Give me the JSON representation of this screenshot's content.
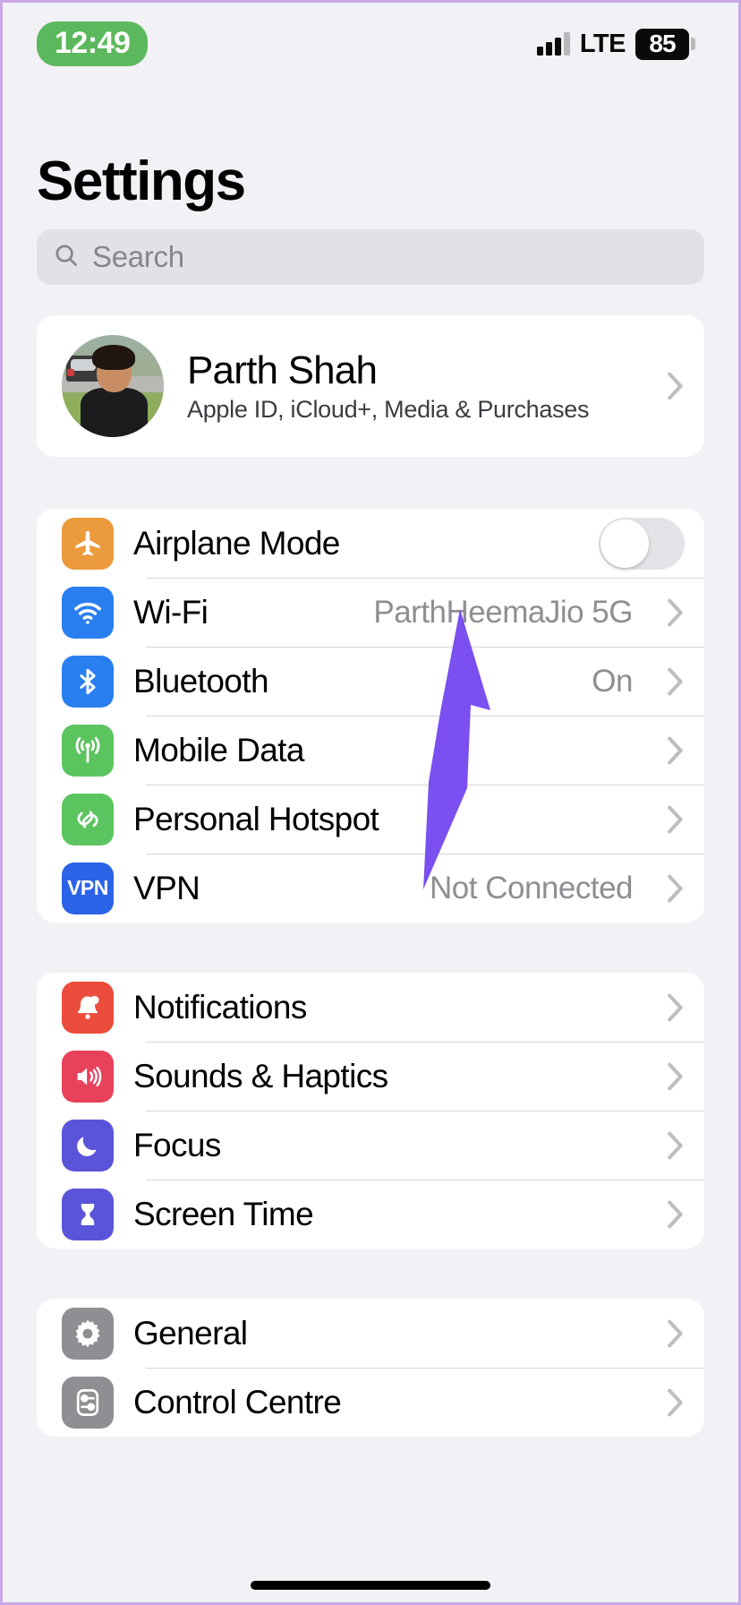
{
  "status_bar": {
    "time": "12:49",
    "network_label": "LTE",
    "battery_level": "85",
    "signal_icon": "cellular-bars-icon",
    "battery_icon": "battery-icon"
  },
  "header": {
    "title": "Settings"
  },
  "search": {
    "placeholder": "Search",
    "icon": "search-icon"
  },
  "account": {
    "name": "Parth Shah",
    "subtitle": "Apple ID, iCloud+, Media & Purchases",
    "avatar_icon": "avatar",
    "chevron_icon": "chevron-right-icon"
  },
  "groups": [
    {
      "id": "connectivity",
      "rows": [
        {
          "label": "Airplane Mode",
          "value": "",
          "icon": "airplane-icon",
          "icon_color": "#eb9a3c",
          "accessory": "toggle",
          "toggle_on": false
        },
        {
          "label": "Wi-Fi",
          "value": "ParthHeemaJio 5G",
          "icon": "wifi-icon",
          "icon_color": "#2a7ff0",
          "accessory": "chevron"
        },
        {
          "label": "Bluetooth",
          "value": "On",
          "icon": "bluetooth-icon",
          "icon_color": "#2a7ff0",
          "accessory": "chevron"
        },
        {
          "label": "Mobile Data",
          "value": "",
          "icon": "mobile-data-icon",
          "icon_color": "#5cc45f",
          "accessory": "chevron"
        },
        {
          "label": "Personal Hotspot",
          "value": "",
          "icon": "personal-hotspot-icon",
          "icon_color": "#5cc45f",
          "accessory": "chevron"
        },
        {
          "label": "VPN",
          "value": "Not Connected",
          "icon": "vpn-icon",
          "icon_color": "#2a62e8",
          "accessory": "chevron"
        }
      ]
    },
    {
      "id": "alerts",
      "rows": [
        {
          "label": "Notifications",
          "value": "",
          "icon": "bell-icon",
          "icon_color": "#eb4c3b",
          "accessory": "chevron"
        },
        {
          "label": "Sounds & Haptics",
          "value": "",
          "icon": "speaker-icon",
          "icon_color": "#e8415c",
          "accessory": "chevron"
        },
        {
          "label": "Focus",
          "value": "",
          "icon": "moon-icon",
          "icon_color": "#5a55d8",
          "accessory": "chevron"
        },
        {
          "label": "Screen Time",
          "value": "",
          "icon": "hourglass-icon",
          "icon_color": "#5a55d8",
          "accessory": "chevron"
        }
      ]
    },
    {
      "id": "system",
      "rows": [
        {
          "label": "General",
          "value": "",
          "icon": "gear-icon",
          "icon_color": "#8e8e93",
          "accessory": "chevron"
        },
        {
          "label": "Control Centre",
          "value": "",
          "icon": "control-centre-icon",
          "icon_color": "#8e8e93",
          "accessory": "chevron"
        }
      ]
    }
  ],
  "annotation": {
    "type": "arrow",
    "color": "#7b4ff0",
    "points_to": "Wi-Fi"
  },
  "vpn_badge_text": "VPN"
}
